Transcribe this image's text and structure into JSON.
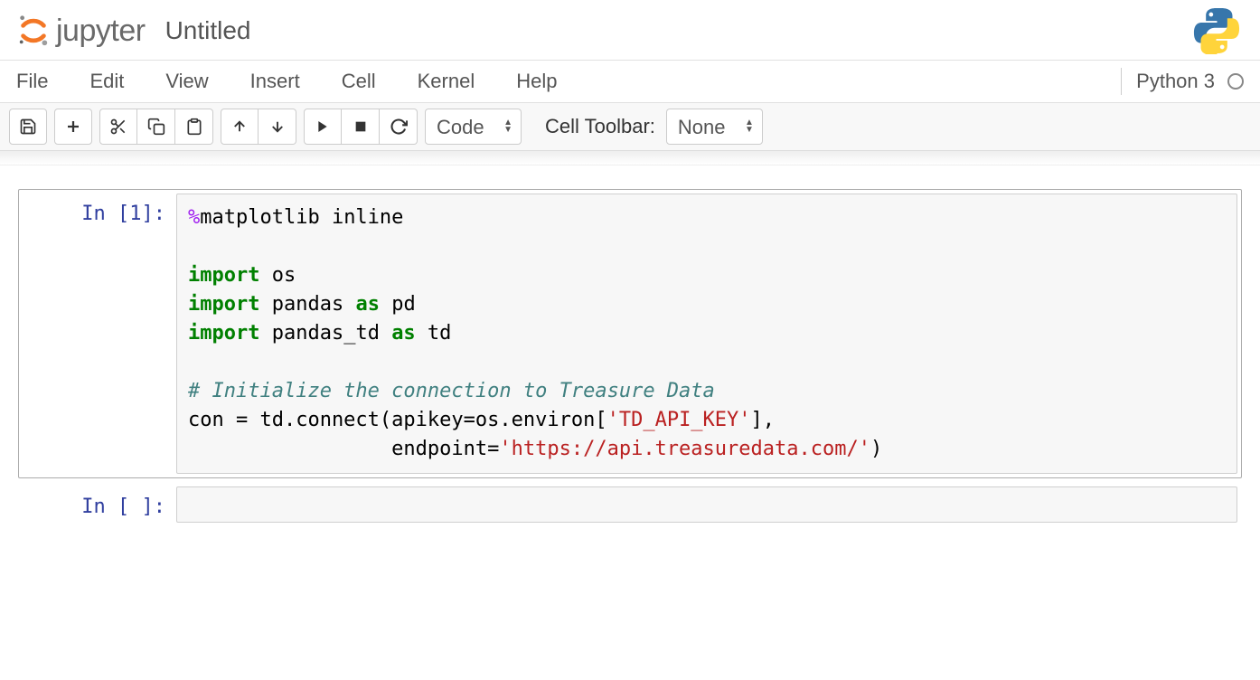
{
  "header": {
    "logo_text": "jupyter",
    "notebook_title": "Untitled"
  },
  "menubar": {
    "items": [
      "File",
      "Edit",
      "View",
      "Insert",
      "Cell",
      "Kernel",
      "Help"
    ],
    "kernel_name": "Python 3"
  },
  "toolbar": {
    "cell_type_selected": "Code",
    "cell_toolbar_label": "Cell Toolbar:",
    "cell_toolbar_selected": "None",
    "icons": {
      "save": "save-icon",
      "add": "plus-icon",
      "cut": "scissors-icon",
      "copy": "copy-icon",
      "paste": "paste-icon",
      "up": "arrow-up-icon",
      "down": "arrow-down-icon",
      "run": "play-icon",
      "stop": "stop-icon",
      "restart": "refresh-icon"
    }
  },
  "cells": [
    {
      "prompt": "In [1]:",
      "code_tokens": [
        {
          "t": "%",
          "c": "cm-magic"
        },
        {
          "t": "matplotlib inline",
          "c": "cm-text"
        },
        {
          "t": "\n\n",
          "c": ""
        },
        {
          "t": "import",
          "c": "cm-kw"
        },
        {
          "t": " os\n",
          "c": "cm-text"
        },
        {
          "t": "import",
          "c": "cm-kw"
        },
        {
          "t": " pandas ",
          "c": "cm-text"
        },
        {
          "t": "as",
          "c": "cm-kw"
        },
        {
          "t": " pd\n",
          "c": "cm-text"
        },
        {
          "t": "import",
          "c": "cm-kw"
        },
        {
          "t": " pandas_td ",
          "c": "cm-text"
        },
        {
          "t": "as",
          "c": "cm-kw"
        },
        {
          "t": " td\n\n",
          "c": "cm-text"
        },
        {
          "t": "# Initialize the connection to Treasure Data",
          "c": "cm-comment"
        },
        {
          "t": "\n",
          "c": ""
        },
        {
          "t": "con = td.connect(apikey=os.environ[",
          "c": "cm-text"
        },
        {
          "t": "'TD_API_KEY'",
          "c": "cm-string"
        },
        {
          "t": "],\n",
          "c": "cm-text"
        },
        {
          "t": "                 endpoint=",
          "c": "cm-text"
        },
        {
          "t": "'https://api.treasuredata.com/'",
          "c": "cm-string"
        },
        {
          "t": ")",
          "c": "cm-text"
        }
      ]
    },
    {
      "prompt": "In [ ]:",
      "code_tokens": []
    }
  ]
}
